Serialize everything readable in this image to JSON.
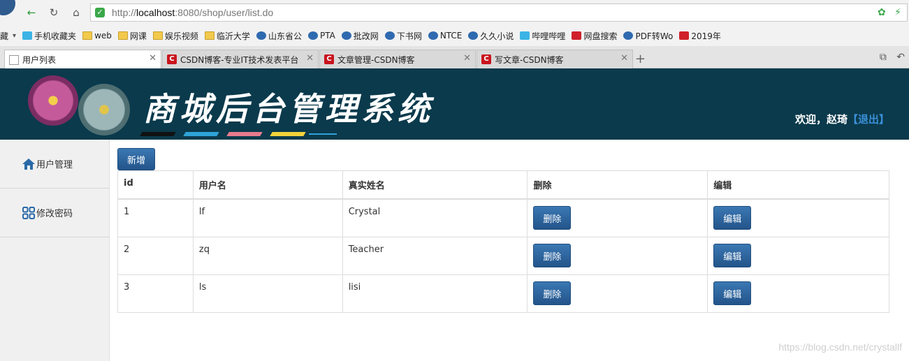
{
  "browser": {
    "url_prefix": "http://",
    "url_host": "localhost",
    "url_rest": ":8080/shop/user/list.do",
    "bookmarks": [
      {
        "label": "藏",
        "icon": "star-icon"
      },
      {
        "label": "手机收藏夹",
        "icon": "phone-icon"
      },
      {
        "label": "web",
        "icon": "folder-icon"
      },
      {
        "label": "网课",
        "icon": "folder-icon"
      },
      {
        "label": "娱乐视频",
        "icon": "folder-icon"
      },
      {
        "label": "临沂大学",
        "icon": "folder-icon"
      },
      {
        "label": "山东省公",
        "icon": "site-icon"
      },
      {
        "label": "PTA",
        "icon": "site-icon"
      },
      {
        "label": "批改网",
        "icon": "site-icon"
      },
      {
        "label": "下书网",
        "icon": "site-icon"
      },
      {
        "label": "NTCE",
        "icon": "site-icon"
      },
      {
        "label": "久久小说",
        "icon": "site-icon"
      },
      {
        "label": "哔哩哔哩",
        "icon": "bilibili-icon"
      },
      {
        "label": "网盘搜索",
        "icon": "search-icon"
      },
      {
        "label": "PDF转Wo",
        "icon": "pdf-icon"
      },
      {
        "label": "2019年",
        "icon": "calendar-icon"
      }
    ],
    "tabs": [
      {
        "label": "用户列表",
        "icon": "page-icon",
        "active": true
      },
      {
        "label": "CSDN博客-专业IT技术发表平台",
        "icon": "csdn-icon"
      },
      {
        "label": "文章管理-CSDN博客",
        "icon": "csdn-icon"
      },
      {
        "label": "写文章-CSDN博客",
        "icon": "csdn-icon"
      }
    ]
  },
  "header": {
    "title": "商城后台管理系统",
    "welcome": "欢迎，赵琦",
    "logout_label": "【退出】"
  },
  "sidebar": {
    "items": [
      {
        "label": "用户管理",
        "icon": "home-icon"
      },
      {
        "label": "修改密码",
        "icon": "grid-icon"
      }
    ]
  },
  "main": {
    "add_label": "新增",
    "columns": [
      "id",
      "用户名",
      "真实姓名",
      "删除",
      "编辑"
    ],
    "delete_label": "删除",
    "edit_label": "编辑",
    "rows": [
      {
        "id": "1",
        "username": "lf",
        "realname": "Crystal"
      },
      {
        "id": "2",
        "username": "zq",
        "realname": "Teacher"
      },
      {
        "id": "3",
        "username": "ls",
        "realname": "lisi"
      }
    ]
  },
  "watermark": "https://blog.csdn.net/crystallf"
}
